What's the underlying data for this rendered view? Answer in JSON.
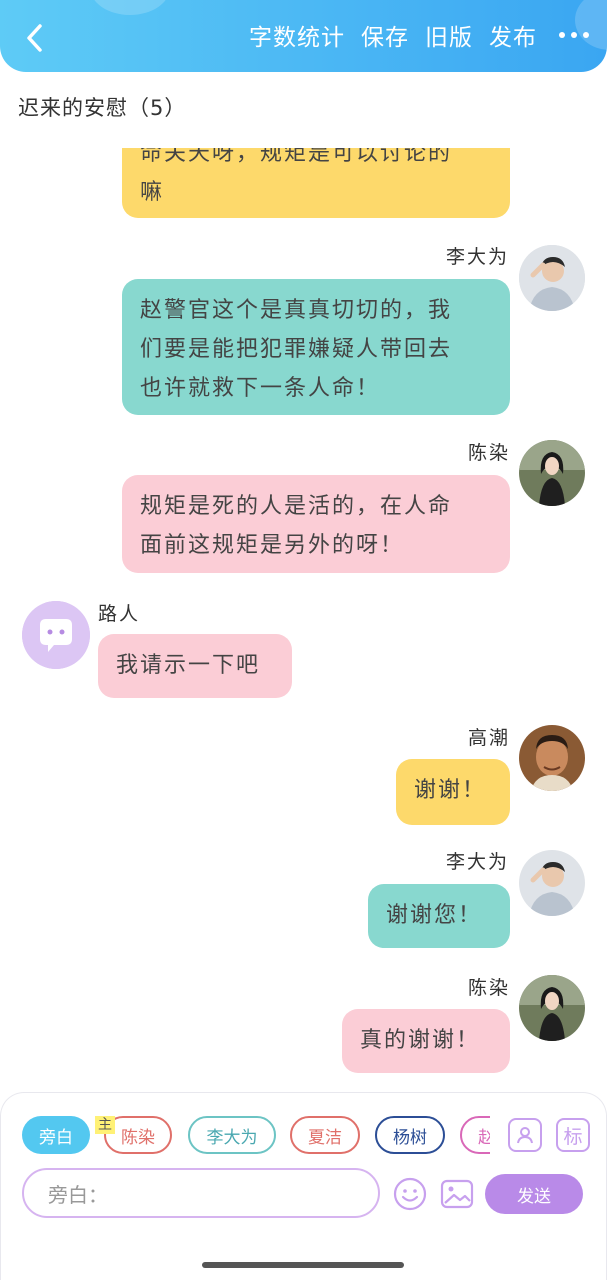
{
  "header": {
    "back_icon": "chevron-left-icon",
    "actions": {
      "word_count": "字数统计",
      "save": "保存",
      "old_version": "旧版",
      "publish": "发布"
    },
    "more_icon": "more-dots-icon",
    "accent_color": "#3aa6f2"
  },
  "chapter": {
    "title": "迟来的安慰（5）"
  },
  "messages": [
    {
      "speaker": "",
      "text_lines": [
        "命关天呀，规矩是可以讨论的",
        "嘛"
      ],
      "color": "#fdd96b"
    },
    {
      "speaker": "李大为",
      "text_lines": [
        "赵警官这个是真真切切的，我",
        "们要是能把犯罪嫌疑人带回去",
        "也许就救下一条人命！"
      ],
      "color": "#88d8cf"
    },
    {
      "speaker": "陈染",
      "text_lines": [
        "规矩是死的人是活的，在人命",
        "面前这规矩是另外的呀！"
      ],
      "color": "#fbcdd6"
    },
    {
      "speaker": "路人",
      "text_lines": [
        "我请示一下吧"
      ],
      "color": "#fbcdd6"
    },
    {
      "speaker": "高潮",
      "text_lines": [
        "谢谢！"
      ],
      "color": "#fdd96b"
    },
    {
      "speaker": "李大为",
      "text_lines": [
        "谢谢您！"
      ],
      "color": "#88d8cf"
    },
    {
      "speaker": "陈染",
      "text_lines": [
        "真的谢谢！"
      ],
      "color": "#fbcdd6"
    }
  ],
  "composer": {
    "roles": {
      "narration": "旁白",
      "main_badge": "主",
      "chenran": "陈染",
      "lidawei": "李大为",
      "xiajie": "夏洁",
      "yangshu": "杨树",
      "partial": "赵"
    },
    "input_placeholder": "旁白：",
    "send_label": "发送",
    "tool_icons": [
      "person-card-icon",
      "tag-icon",
      "emoji-icon",
      "image-icon"
    ],
    "tag_label": "标",
    "send_color": "#b98ae8"
  }
}
